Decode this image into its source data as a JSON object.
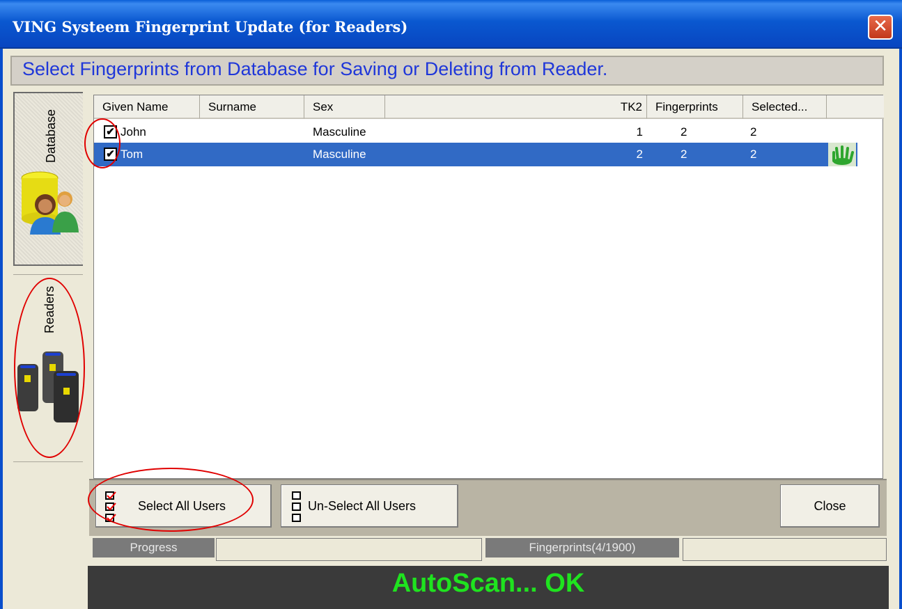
{
  "window": {
    "title": "VING Systeem Fingerprint Update (for Readers)",
    "close_glyph": "✕"
  },
  "header": {
    "instruction": "Select Fingerprints from Database for Saving or Deleting from Reader."
  },
  "sidebar": {
    "tabs": [
      {
        "label": "Database",
        "icon": "database-users-icon"
      },
      {
        "label": "Readers",
        "icon": "fingerprint-readers-icon"
      }
    ]
  },
  "table": {
    "columns": [
      "Given Name",
      "Surname",
      "Sex",
      "TK2",
      "Fingerprints",
      "Selected..."
    ],
    "rows": [
      {
        "checked": true,
        "given_name": "John",
        "surname": "",
        "sex": "Masculine",
        "tk2": "1",
        "fingerprints": "2",
        "selected": "2",
        "selected_row": false
      },
      {
        "checked": true,
        "given_name": "Tom",
        "surname": "",
        "sex": "Masculine",
        "tk2": "2",
        "fingerprints": "2",
        "selected": "2",
        "selected_row": true
      }
    ],
    "check_glyph": "✔"
  },
  "buttons": {
    "select_all": "Select All Users",
    "unselect_all": "Un-Select All Users",
    "close": "Close"
  },
  "status": {
    "progress_label": "Progress",
    "fingerprints_label": "Fingerprints(4/1900)",
    "message": "AutoScan... OK"
  },
  "colors": {
    "title_bar": "#0a58d0",
    "header_text": "#1f37d9",
    "selection": "#316ac5",
    "status_message": "#1fe31f",
    "annotation": "#e00000"
  }
}
